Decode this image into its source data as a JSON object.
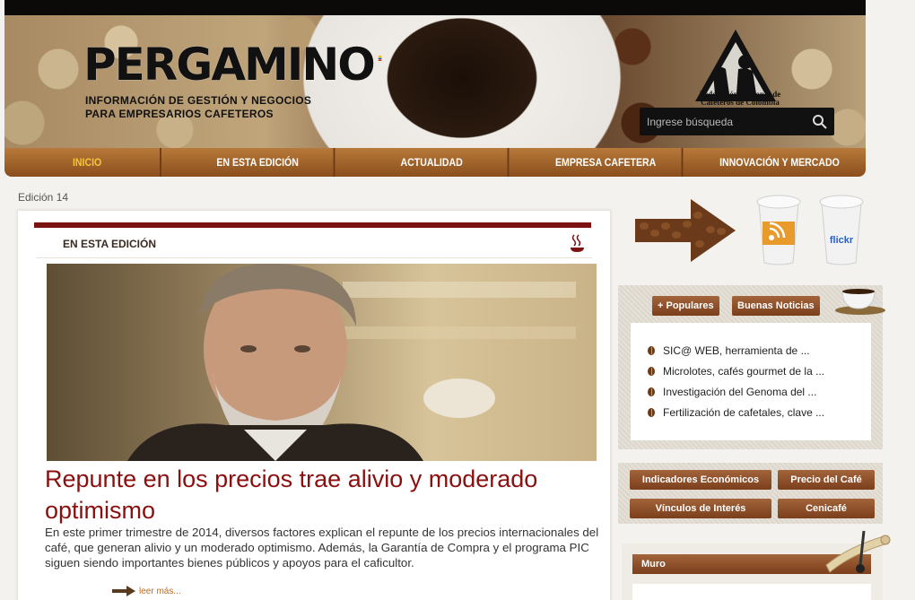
{
  "header": {
    "logo": "PERGAMINO",
    "tagline_line1": "INFORMACIÓN DE GESTIÓN Y NEGOCIOS",
    "tagline_line2": "PARA EMPRESARIOS CAFETEROS",
    "federation_line1": "Federación Nacional de",
    "federation_line2": "Cafeteros de Colombia",
    "search_placeholder": "Ingrese búsqueda"
  },
  "nav": {
    "items": [
      {
        "label": "INICIO",
        "active": true
      },
      {
        "label": "EN ESTA EDICIÓN",
        "active": false
      },
      {
        "label": "ACTUALIDAD",
        "active": false
      },
      {
        "label": "EMPRESA CAFETERA",
        "active": false
      },
      {
        "label": "INNOVACIÓN Y MERCADO",
        "active": false
      }
    ]
  },
  "edition": "Edición 14",
  "main": {
    "section_title": "EN ESTA EDICIÓN",
    "article_title": "Repunte en los precios trae alivio y moderado optimismo",
    "article_body": "En este primer trimestre de 2014, diversos factores explican el repunte de los precios internacionales del café, que generan alivio y un moderado optimismo. Además, la Garantía de Compra y el programa PIC siguen siendo importantes bienes públicos y apoyos para el caficultor.",
    "read_more": "leer más..."
  },
  "sidebar": {
    "cups": {
      "rss": "rss-icon",
      "flickr": "flickr"
    },
    "tabs": {
      "popular": "+ Populares",
      "news": "Buenas Noticias"
    },
    "popular_items": [
      "SIC@ WEB, herramienta de ...",
      "Microlotes, cafés gourmet de la ...",
      "Investigación del Genoma del ...",
      "Fertilización de cafetales, clave ..."
    ],
    "buttons": {
      "indicators": "Indicadores Económicos",
      "price": "Precio del Café",
      "links": "Vínculos de Interés",
      "cenicafe": "Cenicafé"
    },
    "wall_title": "Muro"
  },
  "colors": {
    "nav_active": "#f6c43a",
    "brand_brown": "#8a4e1d",
    "headline_red": "#8a1010",
    "section_bar": "#7a1212"
  }
}
